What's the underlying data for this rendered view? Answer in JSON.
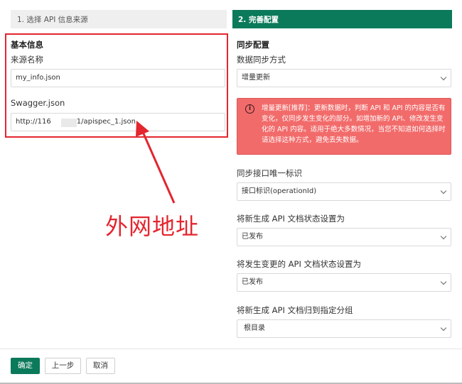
{
  "steps": {
    "step1": "1. 选择 API 信息来源",
    "step2": "2. 完善配置"
  },
  "left": {
    "section_title": "基本信息",
    "source_name_label": "来源名称",
    "source_name_value": "my_info.json",
    "swagger_label": "Swagger.json",
    "swagger_value_prefix": "http://116",
    "swagger_value_suffix": "1/apispec_1.json"
  },
  "right": {
    "section_title": "同步配置",
    "sync_mode_label": "数据同步方式",
    "sync_mode_value": "增量更新",
    "alert_text": "增量更新[推荐]：更新数据时，判断 API 和 API 的内容是否有变化，仅同步发生变化的部分。如增加新的 API、修改发生变化的 API 内容。适用于绝大多数情况，当您不知道如何选择时请选择这种方式，避免丢失数据。",
    "unique_id_label": "同步接口唯一标识",
    "unique_id_value": "接口标识(operationId)",
    "new_status_label": "将新生成 API 文档状态设置为",
    "new_status_value": "已发布",
    "changed_status_label": "将发生变更的 API 文档状态设置为",
    "changed_status_value": "已发布",
    "group_label": "将新生成 API 文档归到指定分组",
    "group_value": "根目录"
  },
  "annotation": {
    "text": "外网地址",
    "color": "#e3262f"
  },
  "footer": {
    "confirm": "确定",
    "prev": "上一步",
    "cancel": "取消"
  },
  "colors": {
    "accent": "#0b7a5a",
    "alert_bg": "#f26b6b",
    "annotation_red": "#e3262f"
  },
  "icons": {
    "alert": "info-circle-icon",
    "select": "chevron-down-icon"
  }
}
